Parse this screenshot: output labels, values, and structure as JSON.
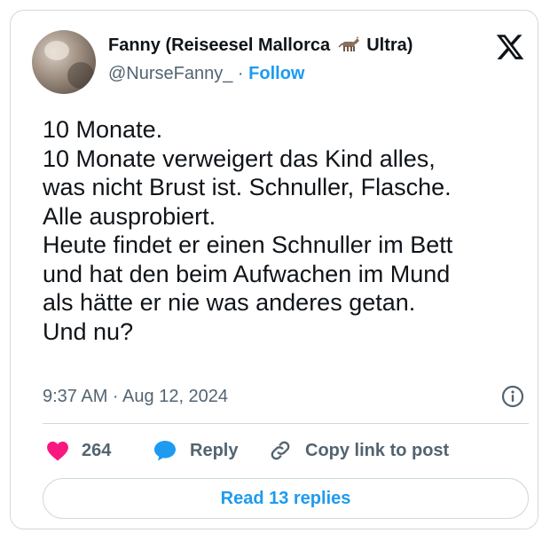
{
  "author": {
    "name_prefix": "Fanny (Reiseesel Mallorca",
    "name_suffix": "Ultra)",
    "handle": "@NurseFanny_",
    "separator": " · ",
    "follow_label": "Follow"
  },
  "tweet": {
    "text": "10 Monate.\n10 Monate verweigert das Kind alles,\nwas nicht Brust ist. Schnuller, Flasche.\nAlle ausprobiert.\nHeute findet er einen Schnuller im Bett\nund hat den beim Aufwachen im Mund\nals hätte er nie was anderes getan.\nUnd nu?",
    "timestamp": "9:37 AM · Aug 12, 2024"
  },
  "actions": {
    "like_count": "264",
    "reply_label": "Reply",
    "copy_label": "Copy link to post"
  },
  "read_replies_label": "Read 13 replies",
  "icons": [
    "donkey-emoji-icon",
    "x-logo-icon",
    "info-icon",
    "heart-icon",
    "reply-bubble-icon",
    "link-icon"
  ],
  "colors": {
    "accent": "#1d9bf0",
    "like": "#f91880",
    "text": "#0f1419",
    "muted": "#536471",
    "border": "#cfd9de"
  }
}
